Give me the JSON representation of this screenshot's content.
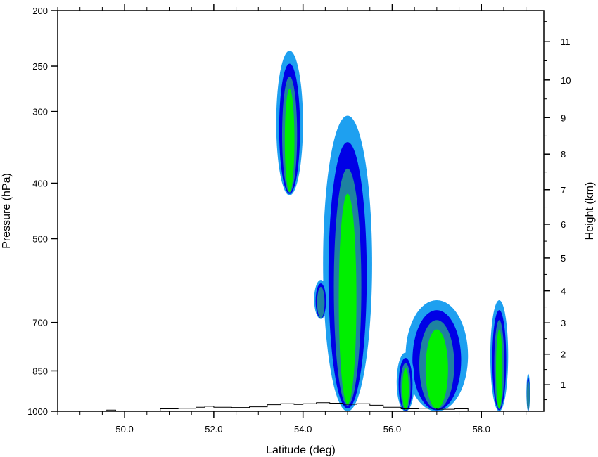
{
  "chart_data": {
    "type": "contour",
    "title": "",
    "xlabel": "Latitude (deg)",
    "ylabel_left": "Pressure (hPa)",
    "ylabel_right": "Height (km)",
    "xlim": [
      48.5,
      59.4
    ],
    "ylim_pressure": [
      1000,
      200
    ],
    "y_scale": "log-pressure",
    "x_ticks": [
      50,
      52,
      54,
      56,
      58
    ],
    "x_tick_labels": [
      "50.0",
      "52.0",
      "54.0",
      "56.0",
      "58.0"
    ],
    "pressure_ticks": [
      1000,
      850,
      700,
      500,
      400,
      300,
      250,
      200
    ],
    "pressure_tick_labels": [
      "1000",
      "850",
      "700",
      "500",
      "400",
      "300",
      "250",
      "200"
    ],
    "height_ticks": [
      1,
      2,
      3,
      4,
      5,
      6,
      7,
      8,
      9,
      10,
      11
    ],
    "height_tick_labels": [
      "1",
      "2",
      "3",
      "4",
      "5",
      "6",
      "7",
      "8",
      "9",
      "10",
      "11"
    ],
    "grid": false,
    "contour_colors": [
      "#1ea0f0",
      "#0000e6",
      "#1e82a0",
      "#00f000"
    ],
    "cells": [
      {
        "lat": 53.7,
        "lat_half_width": 0.3,
        "p_top": 235,
        "p_bottom": 420,
        "levels": 4
      },
      {
        "lat": 55.0,
        "lat_half_width": 0.55,
        "p_top": 305,
        "p_bottom": 1000,
        "levels": 4
      },
      {
        "lat": 54.4,
        "lat_half_width": 0.15,
        "p_top": 590,
        "p_bottom": 690,
        "levels": 3
      },
      {
        "lat": 57.0,
        "lat_half_width": 0.7,
        "p_top": 640,
        "p_bottom": 1000,
        "levels": 4
      },
      {
        "lat": 56.3,
        "lat_half_width": 0.2,
        "p_top": 790,
        "p_bottom": 1000,
        "levels": 4
      },
      {
        "lat": 58.4,
        "lat_half_width": 0.2,
        "p_top": 640,
        "p_bottom": 1000,
        "levels": 4
      },
      {
        "lat": 59.05,
        "lat_half_width": 0.04,
        "p_top": 860,
        "p_bottom": 1000,
        "levels": 3
      }
    ],
    "terrain_profile": {
      "lat": [
        49.6,
        49.8,
        50.8,
        51.2,
        51.6,
        51.8,
        52.0,
        52.4,
        52.8,
        53.2,
        53.5,
        53.8,
        54.0,
        54.3,
        54.6,
        54.9,
        55.2,
        55.5,
        55.8,
        56.2,
        56.6,
        57.0,
        57.4,
        57.7
      ],
      "surface_pressure": [
        995,
        1000,
        990,
        988,
        984,
        980,
        984,
        985,
        982,
        974,
        970,
        973,
        970,
        966,
        968,
        972,
        970,
        976,
        984,
        990,
        988,
        992,
        990,
        1000
      ]
    }
  }
}
